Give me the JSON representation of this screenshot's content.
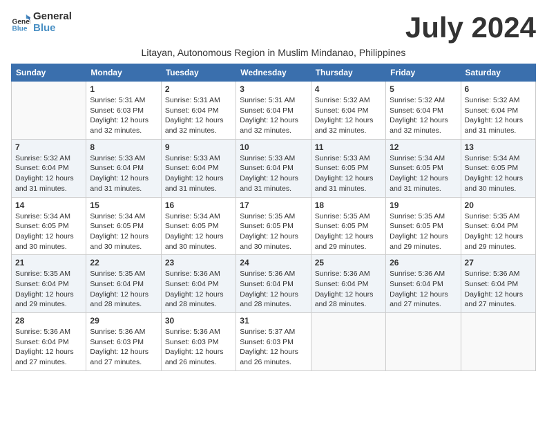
{
  "header": {
    "logo_line1": "General",
    "logo_line2": "Blue",
    "month_year": "July 2024",
    "subtitle": "Litayan, Autonomous Region in Muslim Mindanao, Philippines"
  },
  "days_of_week": [
    "Sunday",
    "Monday",
    "Tuesday",
    "Wednesday",
    "Thursday",
    "Friday",
    "Saturday"
  ],
  "weeks": [
    [
      {
        "day": "",
        "sunrise": "",
        "sunset": "",
        "daylight": ""
      },
      {
        "day": "1",
        "sunrise": "5:31 AM",
        "sunset": "6:03 PM",
        "daylight": "12 hours and 32 minutes."
      },
      {
        "day": "2",
        "sunrise": "5:31 AM",
        "sunset": "6:04 PM",
        "daylight": "12 hours and 32 minutes."
      },
      {
        "day": "3",
        "sunrise": "5:31 AM",
        "sunset": "6:04 PM",
        "daylight": "12 hours and 32 minutes."
      },
      {
        "day": "4",
        "sunrise": "5:32 AM",
        "sunset": "6:04 PM",
        "daylight": "12 hours and 32 minutes."
      },
      {
        "day": "5",
        "sunrise": "5:32 AM",
        "sunset": "6:04 PM",
        "daylight": "12 hours and 32 minutes."
      },
      {
        "day": "6",
        "sunrise": "5:32 AM",
        "sunset": "6:04 PM",
        "daylight": "12 hours and 31 minutes."
      }
    ],
    [
      {
        "day": "7",
        "sunrise": "5:32 AM",
        "sunset": "6:04 PM",
        "daylight": "12 hours and 31 minutes."
      },
      {
        "day": "8",
        "sunrise": "5:33 AM",
        "sunset": "6:04 PM",
        "daylight": "12 hours and 31 minutes."
      },
      {
        "day": "9",
        "sunrise": "5:33 AM",
        "sunset": "6:04 PM",
        "daylight": "12 hours and 31 minutes."
      },
      {
        "day": "10",
        "sunrise": "5:33 AM",
        "sunset": "6:04 PM",
        "daylight": "12 hours and 31 minutes."
      },
      {
        "day": "11",
        "sunrise": "5:33 AM",
        "sunset": "6:05 PM",
        "daylight": "12 hours and 31 minutes."
      },
      {
        "day": "12",
        "sunrise": "5:34 AM",
        "sunset": "6:05 PM",
        "daylight": "12 hours and 31 minutes."
      },
      {
        "day": "13",
        "sunrise": "5:34 AM",
        "sunset": "6:05 PM",
        "daylight": "12 hours and 30 minutes."
      }
    ],
    [
      {
        "day": "14",
        "sunrise": "5:34 AM",
        "sunset": "6:05 PM",
        "daylight": "12 hours and 30 minutes."
      },
      {
        "day": "15",
        "sunrise": "5:34 AM",
        "sunset": "6:05 PM",
        "daylight": "12 hours and 30 minutes."
      },
      {
        "day": "16",
        "sunrise": "5:34 AM",
        "sunset": "6:05 PM",
        "daylight": "12 hours and 30 minutes."
      },
      {
        "day": "17",
        "sunrise": "5:35 AM",
        "sunset": "6:05 PM",
        "daylight": "12 hours and 30 minutes."
      },
      {
        "day": "18",
        "sunrise": "5:35 AM",
        "sunset": "6:05 PM",
        "daylight": "12 hours and 29 minutes."
      },
      {
        "day": "19",
        "sunrise": "5:35 AM",
        "sunset": "6:05 PM",
        "daylight": "12 hours and 29 minutes."
      },
      {
        "day": "20",
        "sunrise": "5:35 AM",
        "sunset": "6:04 PM",
        "daylight": "12 hours and 29 minutes."
      }
    ],
    [
      {
        "day": "21",
        "sunrise": "5:35 AM",
        "sunset": "6:04 PM",
        "daylight": "12 hours and 29 minutes."
      },
      {
        "day": "22",
        "sunrise": "5:35 AM",
        "sunset": "6:04 PM",
        "daylight": "12 hours and 28 minutes."
      },
      {
        "day": "23",
        "sunrise": "5:36 AM",
        "sunset": "6:04 PM",
        "daylight": "12 hours and 28 minutes."
      },
      {
        "day": "24",
        "sunrise": "5:36 AM",
        "sunset": "6:04 PM",
        "daylight": "12 hours and 28 minutes."
      },
      {
        "day": "25",
        "sunrise": "5:36 AM",
        "sunset": "6:04 PM",
        "daylight": "12 hours and 28 minutes."
      },
      {
        "day": "26",
        "sunrise": "5:36 AM",
        "sunset": "6:04 PM",
        "daylight": "12 hours and 27 minutes."
      },
      {
        "day": "27",
        "sunrise": "5:36 AM",
        "sunset": "6:04 PM",
        "daylight": "12 hours and 27 minutes."
      }
    ],
    [
      {
        "day": "28",
        "sunrise": "5:36 AM",
        "sunset": "6:04 PM",
        "daylight": "12 hours and 27 minutes."
      },
      {
        "day": "29",
        "sunrise": "5:36 AM",
        "sunset": "6:03 PM",
        "daylight": "12 hours and 27 minutes."
      },
      {
        "day": "30",
        "sunrise": "5:36 AM",
        "sunset": "6:03 PM",
        "daylight": "12 hours and 26 minutes."
      },
      {
        "day": "31",
        "sunrise": "5:37 AM",
        "sunset": "6:03 PM",
        "daylight": "12 hours and 26 minutes."
      },
      {
        "day": "",
        "sunrise": "",
        "sunset": "",
        "daylight": ""
      },
      {
        "day": "",
        "sunrise": "",
        "sunset": "",
        "daylight": ""
      },
      {
        "day": "",
        "sunrise": "",
        "sunset": "",
        "daylight": ""
      }
    ]
  ],
  "labels": {
    "sunrise_prefix": "Sunrise: ",
    "sunset_prefix": "Sunset: ",
    "daylight_prefix": "Daylight: "
  }
}
